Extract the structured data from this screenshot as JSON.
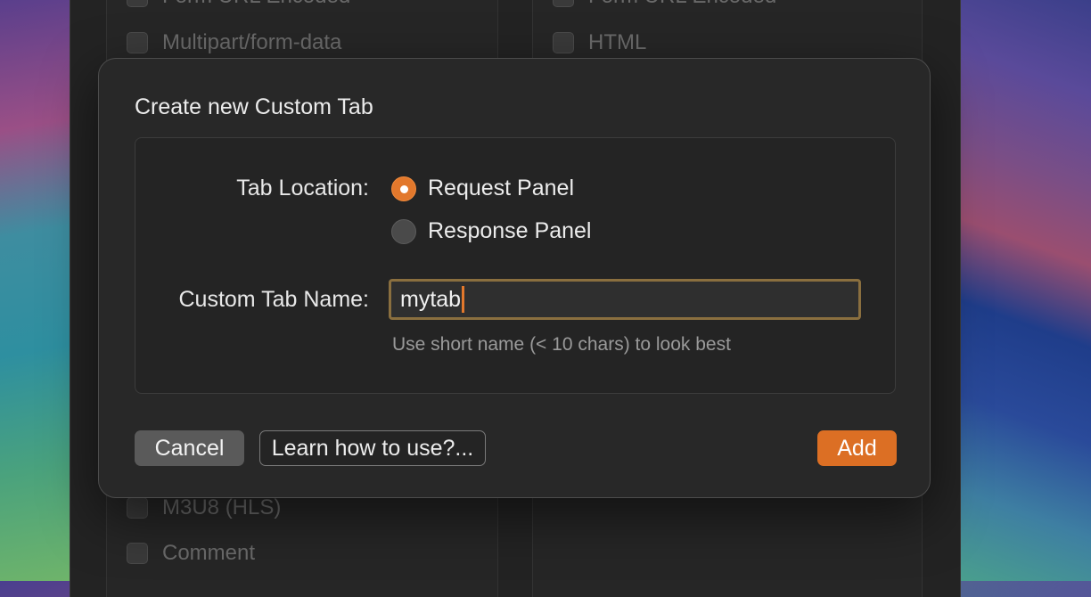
{
  "background_window": {
    "left_column_items": [
      "Form URL Encoded",
      "Multipart/form-data",
      "M3U8 (HLS)",
      "Comment"
    ],
    "right_column_items": [
      "Form URL Encoded",
      "HTML"
    ]
  },
  "dialog": {
    "title": "Create new Custom Tab",
    "tab_location": {
      "label": "Tab Location:",
      "options": [
        {
          "label": "Request Panel",
          "selected": true
        },
        {
          "label": "Response Panel",
          "selected": false
        }
      ]
    },
    "custom_tab_name": {
      "label": "Custom Tab Name:",
      "value": "mytab",
      "hint": "Use short name (< 10 chars) to look best"
    },
    "buttons": {
      "cancel": "Cancel",
      "learn": "Learn how to use?...",
      "add": "Add"
    }
  },
  "colors": {
    "accent": "#dc6f24",
    "focus_border": "#8a6f3f",
    "dialog_bg": "#282828"
  }
}
